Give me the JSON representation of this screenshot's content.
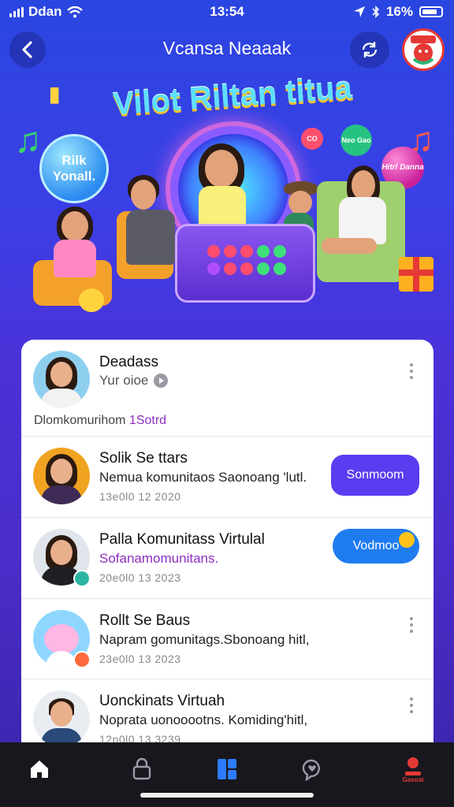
{
  "status_bar": {
    "carrier": "Ddan",
    "time": "13:54",
    "battery": "16%"
  },
  "header": {
    "title": "Vcansa Neaaak",
    "back_icon": "chevron-left-icon",
    "refresh_icon": "refresh-icon"
  },
  "hero": {
    "title": "Vilot Riltan titua",
    "bubble_left": "Rilk Yonall.",
    "bubble_right": "Hitrl Danna",
    "chips": [
      "CO",
      "Neo Gao"
    ]
  },
  "featured": {
    "name": "Deadass",
    "subtitle": "Yur oioe",
    "footnote_prefix": "Dlomkomurihom",
    "footnote_link": "1Sotrd"
  },
  "communities": [
    {
      "title": "Solik Se ttars",
      "subtitle": "Nemua komunitaos Saonoang 'lutl.",
      "date": "13e0l0 12 2020",
      "action_label": "Sonmoom",
      "avatar_icon": "avatar-woman",
      "action_color": "#5b3cf0"
    },
    {
      "title": "Palla Komunitass Virtulal",
      "subtitle": "Sofanamomunitans.",
      "date": "20e0l0 13 2023",
      "action_label": "Vodmoo",
      "avatar_icon": "avatar-woman-2",
      "action_color": "#1f7cf0"
    },
    {
      "title": "Rollt Se Baus",
      "subtitle": "Napram gomunitags.Sbonoang hitl,",
      "date": "23e0l0 13 2023",
      "avatar_icon": "mascot-pink"
    },
    {
      "title": "Uonckinats Virtuah",
      "subtitle": "Noprata uonooootns. Komiding'hitl,",
      "date": "12n0l0 13 3239",
      "avatar_icon": "avatar-man"
    }
  ],
  "bottom_nav": [
    {
      "icon": "home-icon",
      "color": "#ffffff"
    },
    {
      "icon": "lock-icon",
      "color": "#9a9aa8"
    },
    {
      "icon": "dashboard-icon",
      "color": "#2d7cff"
    },
    {
      "icon": "heart-chat-icon",
      "color": "#9a9aa8"
    },
    {
      "icon": "profile-icon",
      "color": "#e53935",
      "label": "Gasoat"
    }
  ]
}
